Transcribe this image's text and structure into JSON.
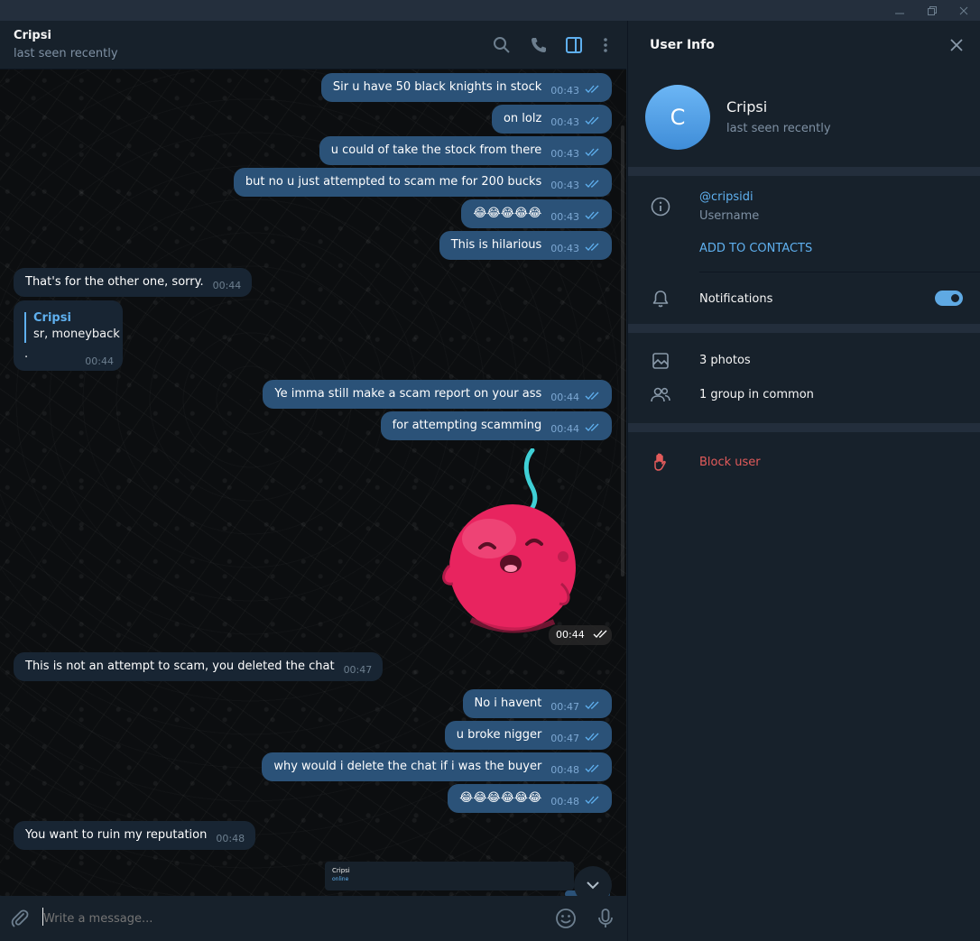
{
  "chat": {
    "name": "Cripsi",
    "status": "last seen recently"
  },
  "messages": [
    {
      "dir": "out",
      "text": "Sir u have 50  black knights in stock",
      "time": "00:43"
    },
    {
      "dir": "out",
      "text": "on lolz",
      "time": "00:43"
    },
    {
      "dir": "out",
      "text": "u could of take the stock from there",
      "time": "00:43"
    },
    {
      "dir": "out",
      "text": "but no u just attempted to scam me for 200 bucks",
      "time": "00:43"
    },
    {
      "dir": "out",
      "text": "😂😂😂😂😂",
      "time": "00:43"
    },
    {
      "dir": "out",
      "text": "This is hilarious",
      "time": "00:43"
    },
    {
      "dir": "in",
      "text": "That's for the other one, sorry.",
      "time": "00:44"
    },
    {
      "dir": "out",
      "text": "Ye imma still make a scam report on your ass",
      "time": "00:44"
    },
    {
      "dir": "out",
      "text": "for attempting scamming",
      "time": "00:44"
    },
    {
      "dir": "in",
      "text": "This is not an attempt to scam, you deleted the chat",
      "time": "00:47"
    },
    {
      "dir": "out",
      "text": "No i havent",
      "time": "00:47"
    },
    {
      "dir": "out",
      "text": "u broke nigger",
      "time": "00:47"
    },
    {
      "dir": "out",
      "text": "why would i delete the chat if i was the buyer",
      "time": "00:48"
    },
    {
      "dir": "out",
      "text": "😂😂😂😂😂😂",
      "time": "00:48"
    },
    {
      "dir": "in",
      "text": "You want to ruin my reputation",
      "time": "00:48"
    }
  ],
  "reply_message": {
    "reply_name": "Cripsi",
    "reply_text": "sr, moneyback",
    "body": ".",
    "time": "00:44"
  },
  "sticker": {
    "time": "00:44"
  },
  "mini_preview": {
    "name": "Cripsi",
    "status": "online"
  },
  "composer": {
    "placeholder": "Write a message..."
  },
  "panel": {
    "title": "User Info",
    "avatar_letter": "C",
    "name": "Cripsi",
    "status": "last seen recently",
    "username": "@cripsidi",
    "username_label": "Username",
    "add_contacts": "ADD TO CONTACTS",
    "notifications_label": "Notifications",
    "notifications_on": true,
    "photos": "3 photos",
    "groups": "1 group in common",
    "block": "Block user"
  },
  "colors": {
    "accent": "#5fb0ef",
    "outgoing_bubble": "#2b5278",
    "incoming_bubble": "#182533",
    "danger": "#e35b5b",
    "sticker_body": "#e8245f"
  }
}
